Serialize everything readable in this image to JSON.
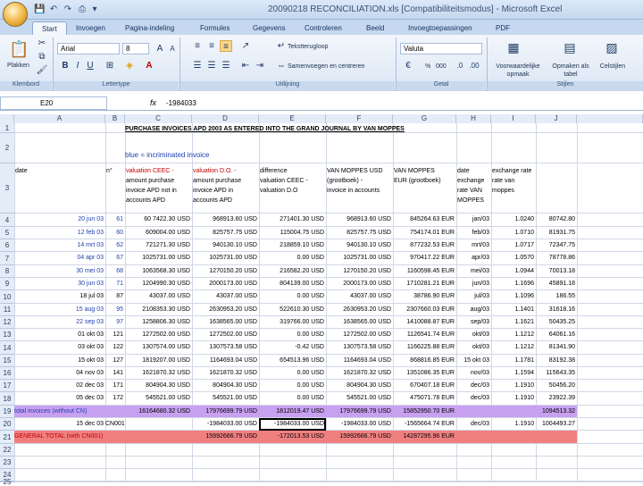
{
  "window": {
    "title": "20090218 RECONCILIATION.xls [Compatibiliteitsmodus] - Microsoft Excel"
  },
  "tabs": [
    "Start",
    "Invoegen",
    "Pagina-indeling",
    "Formules",
    "Gegevens",
    "Controleren",
    "Beeld",
    "Invoegtoepassingen",
    "PDF"
  ],
  "ribbon": {
    "paste": "Plakken",
    "font_name": "Arial",
    "font_size": "8",
    "wrap_text": "Tekstterugloop",
    "merge_center": "Samenvoegen en centreren",
    "number_format": "Valuta",
    "percent": "%",
    "thousands": "000",
    "cond_format": "Voorwaardelijke opmaak",
    "format_table": "Opmaken als tabel",
    "cell_styles": "Celstijlen",
    "groups": {
      "clipboard": "Klembord",
      "font": "Lettertype",
      "alignment": "Uitlijning",
      "number": "Getal",
      "styles": "Stijlen"
    }
  },
  "formula_bar": {
    "name_box": "E20",
    "fx": "fx",
    "value": "-1984033"
  },
  "columns": [
    "A",
    "B",
    "C",
    "D",
    "E",
    "F",
    "G",
    "H",
    "I",
    "J"
  ],
  "sheet": {
    "title": "PURCHASE INVOICES APD 2003 AS ENTERED INTO THE GRAND JOURNAL BY VAN MOPPES",
    "subtitle": "blue = incriminated invoice",
    "headers": {
      "a": "date",
      "b": "n°",
      "c1": "valuation CEEC -",
      "c2": "amount purchase",
      "c3": "invoice APD not in",
      "c4": "accounts APD",
      "d1": "valuation D.O. -",
      "d2": "amount purchase",
      "d3": "invoice APD in",
      "d4": "accounts APD",
      "e1": "difference",
      "e2": "valuation CEEC -",
      "e3": "valuation D.O",
      "f1": "VAN MOPPES USD",
      "f2": "(grootboek) -",
      "f3": "invoice in accounts",
      "g1": "VAN MOPPES",
      "g2": "EUR (grootboek)",
      "h1": "date",
      "h2": "exchange",
      "h3": "rate VAN",
      "h4": "MOPPES",
      "i1": "exchange rate",
      "i2": "rate van",
      "i3": "moppes"
    },
    "rows": [
      {
        "n": 4,
        "date": "20 jun 03",
        "no": "61",
        "c": "60 7422.30 USD",
        "d": "968913.60 USD",
        "e": "271401.30 USD",
        "f": "968913.60 USD",
        "g": "845264.63 EUR",
        "h": "jan/03",
        "i": "1.0240",
        "j": "80742.80",
        "blue": true
      },
      {
        "n": 5,
        "date": "12 feb 03",
        "no": "60",
        "c": "609004.00 USD",
        "d": "825757.75 USD",
        "e": "115004.75 USD",
        "f": "825757.75 USD",
        "g": "754174.01 EUR",
        "h": "feb/03",
        "i": "1.0710",
        "j": "81931.75",
        "blue": true
      },
      {
        "n": 6,
        "date": "14 mrt 03",
        "no": "62",
        "c": "721271.30 USD",
        "d": "940130.10 USD",
        "e": "218859.10 USD",
        "f": "940130.10 USD",
        "g": "877232.53 EUR",
        "h": "mrt/03",
        "i": "1.0717",
        "j": "72347.75",
        "blue": true
      },
      {
        "n": 7,
        "date": "04 apr 03",
        "no": "67",
        "c": "1025731.00 USD",
        "d": "1025731.00 USD",
        "e": "0.00 USD",
        "f": "1025731.00 USD",
        "g": "970417.22 EUR",
        "h": "apr/03",
        "i": "1.0570",
        "j": "78778.86",
        "blue": true
      },
      {
        "n": 8,
        "date": "30 mei 03",
        "no": "68",
        "c": "1063568.30 USD",
        "d": "1270150.20 USD",
        "e": "216582.20 USD",
        "f": "1270150.20 USD",
        "g": "1160598.45 EUR",
        "h": "mei/03",
        "i": "1.0944",
        "j": "70013.18",
        "blue": true
      },
      {
        "n": 9,
        "date": "30 jun 03",
        "no": "71",
        "c": "1204990.30 USD",
        "d": "2000173.00 USD",
        "e": "804139.00 USD",
        "f": "2000173.00 USD",
        "g": "1710281.21 EUR",
        "h": "jun/03",
        "i": "1.1696",
        "j": "45891.18",
        "blue": true
      },
      {
        "n": 10,
        "date": "18 jul 03",
        "no": "87",
        "c": "43037.00 USD",
        "d": "43037.00 USD",
        "e": "0.00 USD",
        "f": "43037.00 USD",
        "g": "38786.90 EUR",
        "h": "jul/03",
        "i": "1.1096",
        "j": "186.55",
        "blue": false
      },
      {
        "n": 11,
        "date": "15 aug 03",
        "no": "95",
        "c": "2108353.30 USD",
        "d": "2630953.20 USD",
        "e": "522610.30 USD",
        "f": "2630953.20 USD",
        "g": "2307660.03 EUR",
        "h": "aug/03",
        "i": "1.1401",
        "j": "31618.16",
        "blue": true
      },
      {
        "n": 12,
        "date": "22 sep 03",
        "no": "97",
        "c": "1258806.30 USD",
        "d": "1638565.00 USD",
        "e": "319766.00 USD",
        "f": "1638565.00 USD",
        "g": "1410088.87 EUR",
        "h": "sep/03",
        "i": "1.1621",
        "j": "50435.25",
        "blue": true
      },
      {
        "n": 13,
        "date": "01 okt 03",
        "no": "121",
        "c": "1272502.00 USD",
        "d": "1272502.00 USD",
        "e": "0.00 USD",
        "f": "1272502.00 USD",
        "g": "1126541.74 EUR",
        "h": "okt/03",
        "i": "1.1212",
        "j": "64061.16",
        "blue": false
      },
      {
        "n": 14,
        "date": "03 okt 03",
        "no": "122",
        "c": "1307574.00 USD",
        "d": "1307573.58 USD",
        "e": "-0.42 USD",
        "f": "1307573.58 USD",
        "g": "1166225.88 EUR",
        "h": "okt/03",
        "i": "1.1212",
        "j": "81341.90",
        "blue": false
      },
      {
        "n": 15,
        "date": "15 okt 03",
        "no": "127",
        "c": "1819207.00 USD",
        "d": "1164693.04 USD",
        "e": "654513.96 USD",
        "f": "1164693.04 USD",
        "g": "868816.85 EUR",
        "h": "15 okt 03",
        "i": "1.1781",
        "j": "83192.38",
        "blue": false
      },
      {
        "n": 16,
        "date": "04 nov 03",
        "no": "141",
        "c": "1621870.32 USD",
        "d": "1621870.32 USD",
        "e": "0.00 USD",
        "f": "1621870.32 USD",
        "g": "1351086.35 EUR",
        "h": "nov/03",
        "i": "1.1594",
        "j": "115643.35",
        "blue": false
      },
      {
        "n": 17,
        "date": "02 dec 03",
        "no": "171",
        "c": "804904.30 USD",
        "d": "804904.30 USD",
        "e": "0.00 USD",
        "f": "804904.30 USD",
        "g": "670407.18 EUR",
        "h": "dec/03",
        "i": "1.1910",
        "j": "50456.20",
        "blue": false
      },
      {
        "n": 18,
        "date": "05 dec 03",
        "no": "172",
        "c": "545521.00 USD",
        "d": "545521.00 USD",
        "e": "0.00 USD",
        "f": "545521.00 USD",
        "g": "475071.78 EUR",
        "h": "dec/03",
        "i": "1.1910",
        "j": "23922.39",
        "blue": false
      }
    ],
    "total_row": {
      "n": 19,
      "label": "total invoices (without CN)",
      "c": "16164680.32 USD",
      "d": "17976699.79 USD",
      "e": "1812019.47 USD",
      "f": "17976699.79 USD",
      "g": "15852950.70 EUR",
      "j": "1094513.32"
    },
    "cn_row": {
      "n": 20,
      "date": "15 dec 03",
      "no": "CN001",
      "d": "-1984033.00 USD",
      "e": "-1984033.00 USD",
      "f": "-1984033.00 USD",
      "g": "-1565664.74 EUR",
      "h": "dec/03",
      "i": "1.1910",
      "j": "1004493.27"
    },
    "grand_row": {
      "n": 21,
      "label": "GENERAL TOTAL (with CN001)",
      "d": "15992666.79 USD",
      "e": "-172013.53 USD",
      "f": "15992666.79 USD",
      "g": "14287295.96 EUR"
    },
    "empty_rows": [
      22,
      23,
      24,
      25,
      26
    ]
  },
  "colors": {
    "purple": "#c8a0f0",
    "red": "#f08080",
    "blue_text": "#1f3fb0"
  }
}
